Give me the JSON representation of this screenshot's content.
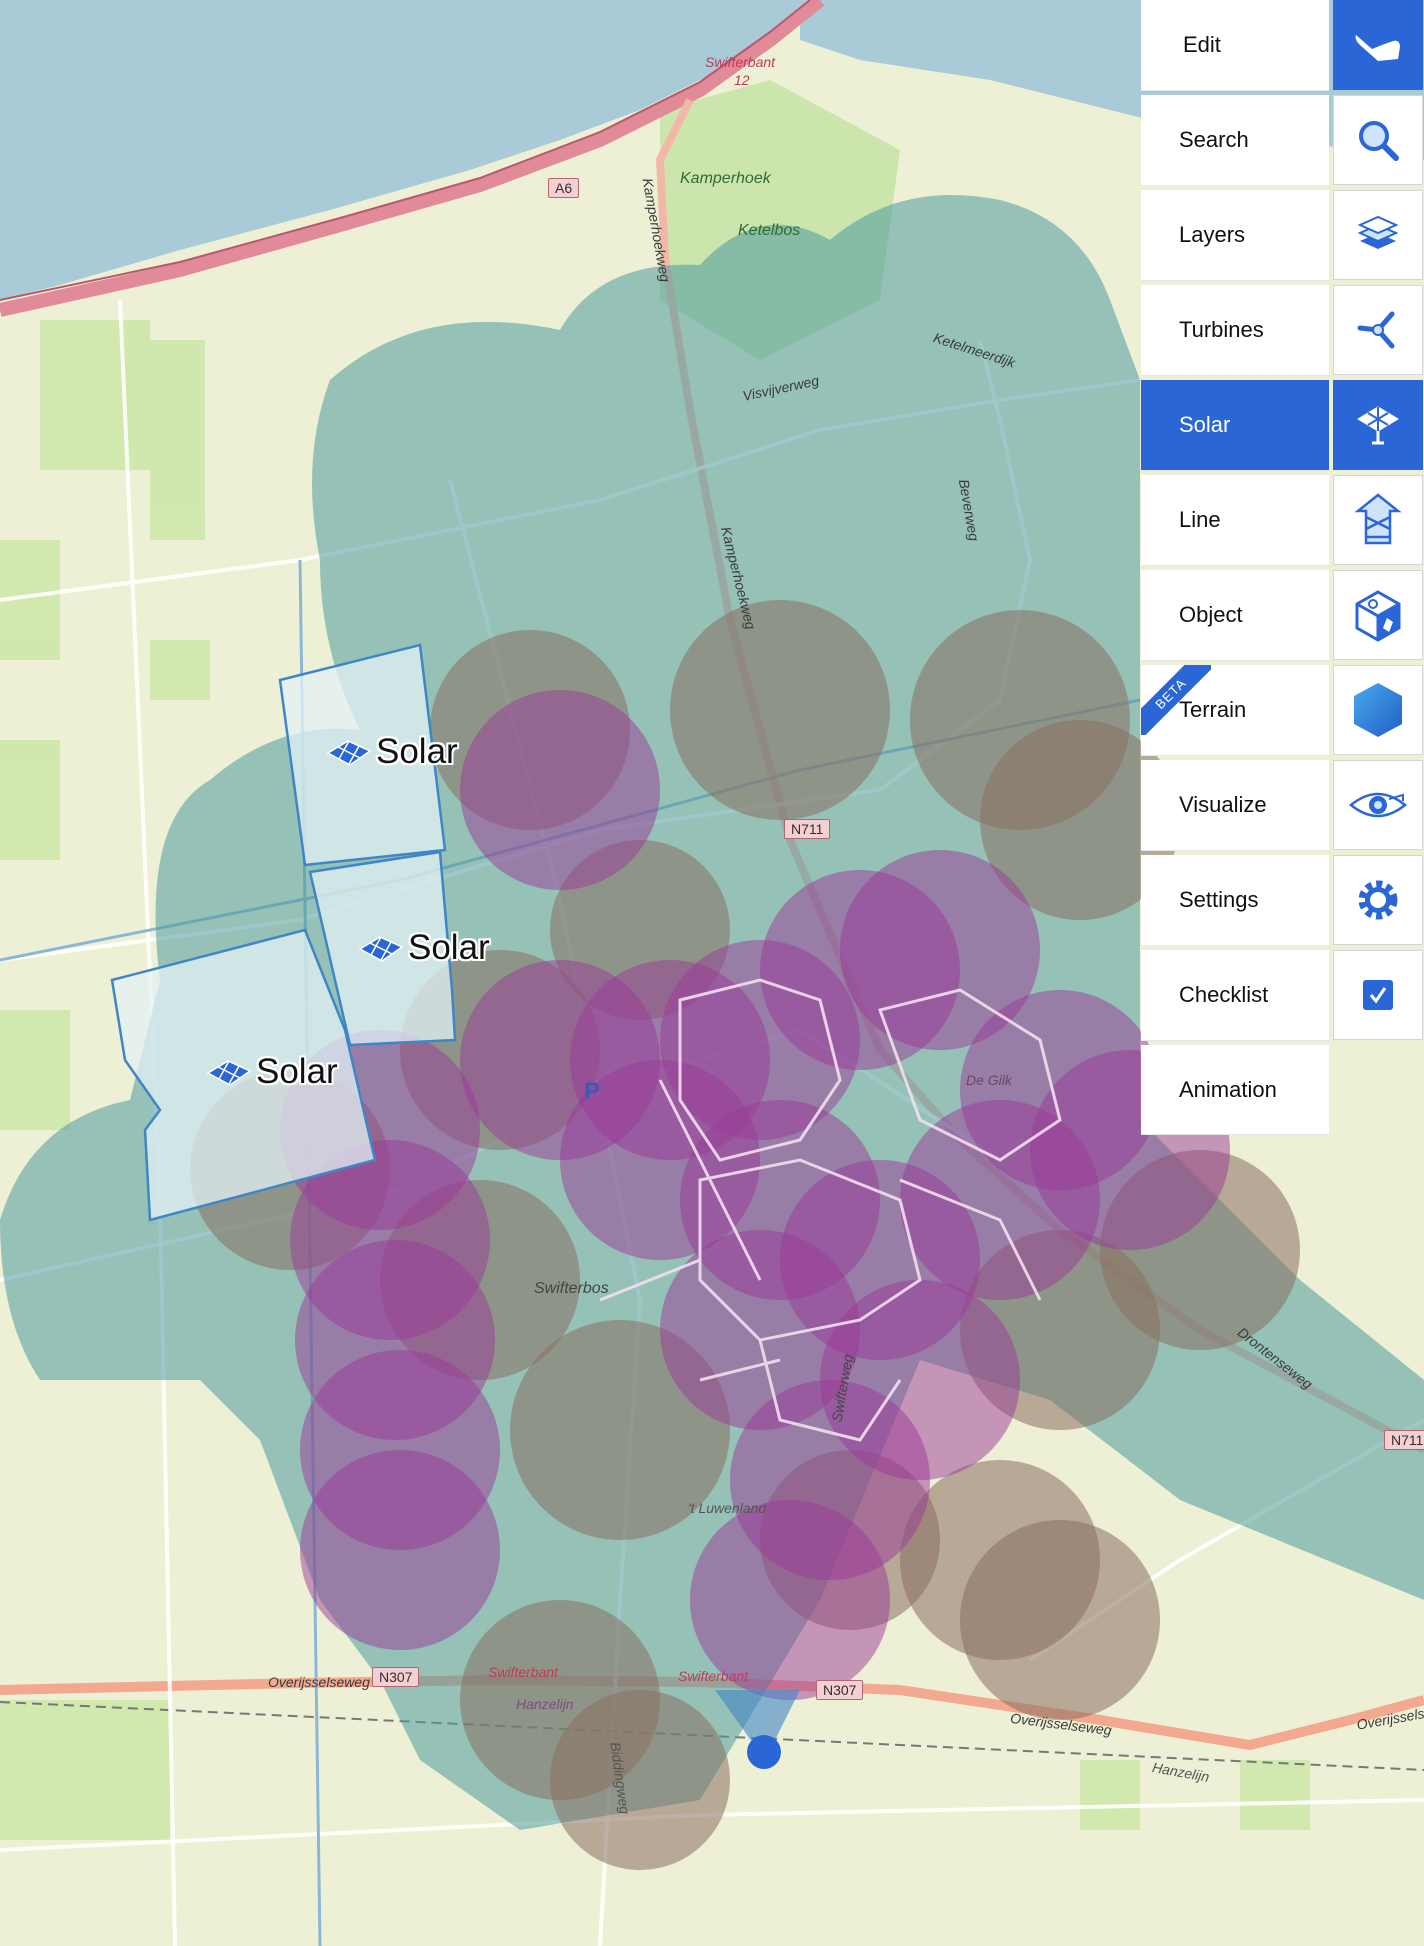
{
  "menu": {
    "items": [
      {
        "label": "Edit",
        "icon": "pointer-hand-icon",
        "active": false
      },
      {
        "label": "Search",
        "icon": "search-icon",
        "active": false
      },
      {
        "label": "Layers",
        "icon": "layers-icon",
        "active": false
      },
      {
        "label": "Turbines",
        "icon": "turbine-icon",
        "active": false
      },
      {
        "label": "Solar",
        "icon": "solar-panel-icon",
        "active": true
      },
      {
        "label": "Line",
        "icon": "line-tower-icon",
        "active": false
      },
      {
        "label": "Object",
        "icon": "object-cube-icon",
        "active": false
      },
      {
        "label": "Terrain",
        "icon": "terrain-hexagon-icon",
        "active": false,
        "badge": "BETA"
      },
      {
        "label": "Visualize",
        "icon": "eye-icon",
        "active": false
      },
      {
        "label": "Settings",
        "icon": "gear-icon",
        "active": false
      },
      {
        "label": "Checklist",
        "icon": "checkbox-icon",
        "active": false
      },
      {
        "label": "Animation",
        "icon": null,
        "active": false
      }
    ]
  },
  "map": {
    "solar_labels": [
      "Solar",
      "Solar",
      "Solar"
    ],
    "place_labels": {
      "swifterbant_exit": "Swifterbant",
      "exit_number": "12",
      "kamperhoek": "Kamperhoek",
      "ketelbos": "Ketelbos",
      "swifterbos": "Swifterbos",
      "luwenland": "'t Luwenland",
      "hanzelijn_left": "Hanzelijn",
      "hanzelijn_right": "Hanzelijn",
      "swifterbant_station_1": "Swifterbant",
      "swifterbant_station_2": "Swifterbant",
      "de_gilk": "De Gilk",
      "parking": "P"
    },
    "road_labels": {
      "kamperhoekweg": "Kamperhoekweg",
      "kampereweg": "Kamperhoekweg",
      "visvijverweg": "Visvijverweg",
      "ketelmeerdijk": "Ketelmeerdijk",
      "beverweg": "Beverweg",
      "overijsselseweg_left": "Overijsselseweg",
      "overijsselseweg_right": "Overijsselseweg",
      "overijsselseweg_far": "Overijsselseweg",
      "biddingweg": "Biddingweg",
      "dronterweg": "Drontenseweg",
      "swifterweg": "Swifterweg"
    },
    "shields": {
      "a6": "A6",
      "n711_mid": "N711",
      "n711_right": "N711",
      "n307_left": "N307",
      "n307_right": "N307"
    },
    "colors": {
      "water": "#a9cbd8",
      "land": "#eef0d6",
      "teal_buffer": "#4f9a9e",
      "brown_buffer": "#8a6f62",
      "purple_buffer": "#9a3a98",
      "solar_fill": "#d9ecf2",
      "solar_stroke": "#3f86c6",
      "accent": "#2b66d6",
      "motorway": "#e08a9a",
      "primary_road": "#f2b8a7"
    }
  }
}
